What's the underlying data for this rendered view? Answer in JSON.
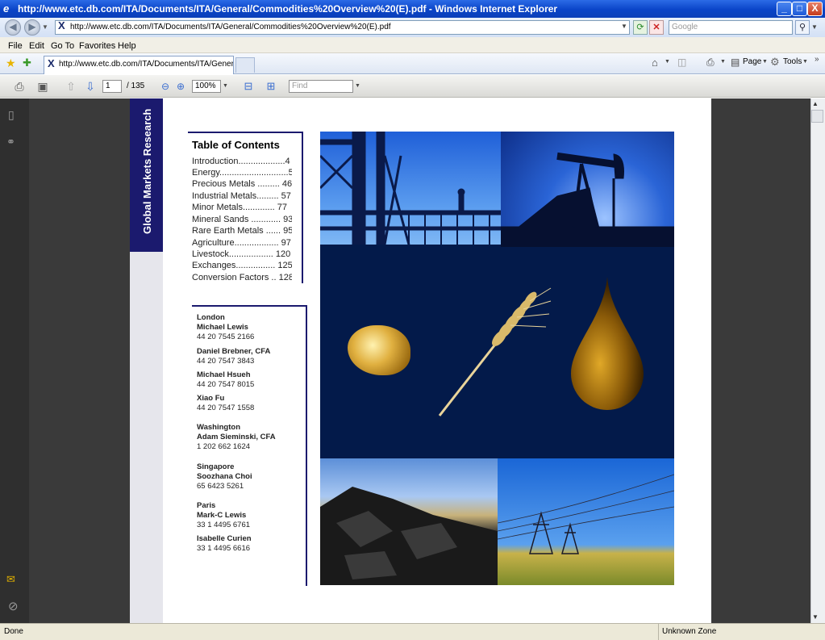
{
  "window": {
    "title": "http://www.etc.db.com/ITA/Documents/ITA/General/Commodities%20Overview%20(E).pdf - Windows Internet Explorer",
    "minimize": "_",
    "maximize": "□",
    "close": "X"
  },
  "address": {
    "url": "http://www.etc.db.com/ITA/Documents/ITA/General/Commodities%20Overview%20(E).pdf",
    "search_placeholder": "Google"
  },
  "menu": [
    "File",
    "Edit",
    "Go To",
    "Favorites",
    "Help"
  ],
  "tab": {
    "label": "http://www.etc.db.com/ITA/Documents/ITA/General/..."
  },
  "commandbar": {
    "page": "Page",
    "tools": "Tools"
  },
  "pdf_toolbar": {
    "current_page": "1",
    "page_total": "/ 135",
    "zoom": "100%",
    "find_placeholder": "Find"
  },
  "document": {
    "side_title": "Global Markets Research",
    "toc_title": "Table of Contents",
    "toc": [
      "Introduction...................4",
      "Energy............................5",
      "Precious Metals ......... 46",
      "Industrial Metals......... 57",
      "Minor Metals............. 77",
      "Mineral Sands ............ 93",
      "Rare Earth Metals ...... 95",
      "Agriculture.................. 97",
      "Livestock.................. 120",
      "Exchanges................ 125",
      "Conversion Factors .. 128"
    ],
    "contacts": [
      {
        "city": "London",
        "name": "Michael Lewis",
        "phone": "44 20 7545 2166"
      },
      {
        "city": "",
        "name": "Daniel Brebner, CFA",
        "phone": "44 20 7547 3843"
      },
      {
        "city": "",
        "name": "Michael Hsueh",
        "phone": "44 20 7547 8015"
      },
      {
        "city": "",
        "name": "Xiao Fu",
        "phone": "44 20 7547 1558"
      },
      {
        "city": "Washington",
        "name": "Adam Sieminski, CFA",
        "phone": "1 202 662 1624"
      },
      {
        "city": "Singapore",
        "name": "Soozhana Choi",
        "phone": "65 6423 5261"
      },
      {
        "city": "Paris",
        "name": "Mark-C Lewis",
        "phone": "33 1 4495 6761"
      },
      {
        "city": "",
        "name": "Isabelle Curien",
        "phone": "33 1 4495 6616"
      }
    ]
  },
  "status": {
    "left": "Done",
    "zone": "Unknown Zone"
  },
  "colors": {
    "brand_navy": "#1b1a6e",
    "titlebar_blue": "#0a44c8"
  }
}
